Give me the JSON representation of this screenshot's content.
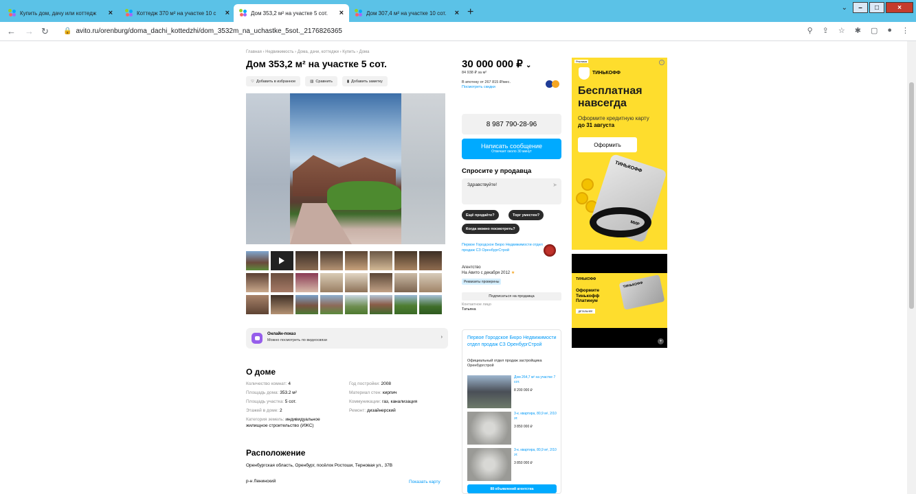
{
  "browser": {
    "tabs": [
      {
        "title": "Купить дом, дачу или коттедж",
        "active": false
      },
      {
        "title": "Коттедж 370 м² на участке 10 с",
        "active": false
      },
      {
        "title": "Дом 353,2 м² на участке 5 сот.",
        "active": true
      },
      {
        "title": "Дом 307,4 м² на участке 10 сот.",
        "active": false
      }
    ],
    "url": "avito.ru/orenburg/doma_dachi_kottedzhi/dom_3532m_na_uchastke_5sot._2176826365"
  },
  "listing": {
    "breadcrumbs": "Главная › Недвижимость › Дома, дачи, коттеджи › Купить › Дома",
    "title": "Дом 353,2 м² на участке 5 сот.",
    "actions": [
      {
        "label": "Добавить в избранное",
        "icon": "heart-icon"
      },
      {
        "label": "Сравнить",
        "icon": "compare-icon"
      },
      {
        "label": "Добавить заметку",
        "icon": "note-icon"
      }
    ],
    "online_show": {
      "title": "Онлайн-показ",
      "subtitle": "Можно посмотреть по видеосвязи"
    }
  },
  "about": {
    "heading": "О доме",
    "params_left": [
      {
        "k": "Количество комнат: ",
        "v": "4"
      },
      {
        "k": "Площадь дома: ",
        "v": "353.2 м²"
      },
      {
        "k": "Площадь участка: ",
        "v": "5 сот."
      },
      {
        "k": "Этажей в доме: ",
        "v": "2"
      },
      {
        "k": "Категория земель: ",
        "v": "индивидуальное жилищное строительство (ИЖС)"
      }
    ],
    "params_right": [
      {
        "k": "Год постройки: ",
        "v": "2008"
      },
      {
        "k": "Материал стен: ",
        "v": "кирпич"
      },
      {
        "k": "Коммуникации: ",
        "v": "газ, канализация"
      },
      {
        "k": "Ремонт: ",
        "v": "дизайнерский"
      }
    ]
  },
  "location": {
    "heading": "Расположение",
    "address": "Оренбургская область, Оренбург, посёлок Ростоши, Терновая ул., 37В",
    "district": "р-н Ленинский",
    "show_map": "Показать карту"
  },
  "sidebar": {
    "price": "30 000 000 ₽",
    "price_per_m": "84 938 ₽ за м²",
    "mortgage": "В ипотеку от 267 815 ₽/мес.",
    "mortgage_link": "Посмотреть скидки",
    "phone": "8 987 790-28-96",
    "message_btn": "Написать сообщение",
    "message_sub": "Отвечает около 30 минут",
    "ask_heading": "Спросите у продавца",
    "ask_placeholder": "Здравствуйте!",
    "chips": [
      "Ещё продаёте?",
      "Торг уместен?",
      "Когда можно посмотреть?"
    ],
    "seller_name": "Первое Городское Бюро Недвижимости отдел продаж СЗ ОренбургСтрой",
    "seller_type": "Агентство",
    "seller_since": "На Авито с декабря 2012",
    "verified": "Реквизиты проверены",
    "subscribe": "Подписаться на продавца",
    "contact_label": "Контактное лицо",
    "contact_name": "Татьяна"
  },
  "agency": {
    "name": "Первое Городское Бюро Недвижимости отдел продаж СЗ ОренбургСтрой",
    "desc": "Официальный отдел продаж застройщика Оренбургстрой",
    "listings": [
      {
        "title": "Дом 264,7 м² на участке 7 сот.",
        "price": "8 200 000 ₽"
      },
      {
        "title": "3-к. квартира, 80,9 м², 2/10 эт.",
        "price": "3 850 000 ₽"
      },
      {
        "title": "3-к. квартира, 80,9 м², 2/10 эт.",
        "price": "3 850 000 ₽"
      }
    ],
    "all_btn": "88 объявлений агентства"
  },
  "ads": {
    "ad1": {
      "label": "Реклама",
      "brand": "ТИНЬКОФФ",
      "headline": "Бесплатная навсегда",
      "sub": "Оформите кредитную карту",
      "sub_bold": "до 31 августа",
      "cta": "Оформить",
      "card_text": "ТИНЬКОФФ",
      "card_mark": "МИР"
    },
    "ad2": {
      "brand": "ТИНЬКОФФ",
      "text": "Оформите Тинькофф Платинум",
      "btn": "ДЕТАЛЬНЕЕ",
      "card_text": "ТИНЬКОФФ"
    }
  },
  "colors": {
    "accent": "#00aaff",
    "link": "#0099f7",
    "chrome": "#5bc2e7",
    "ad_yellow": "#fedd2d"
  }
}
